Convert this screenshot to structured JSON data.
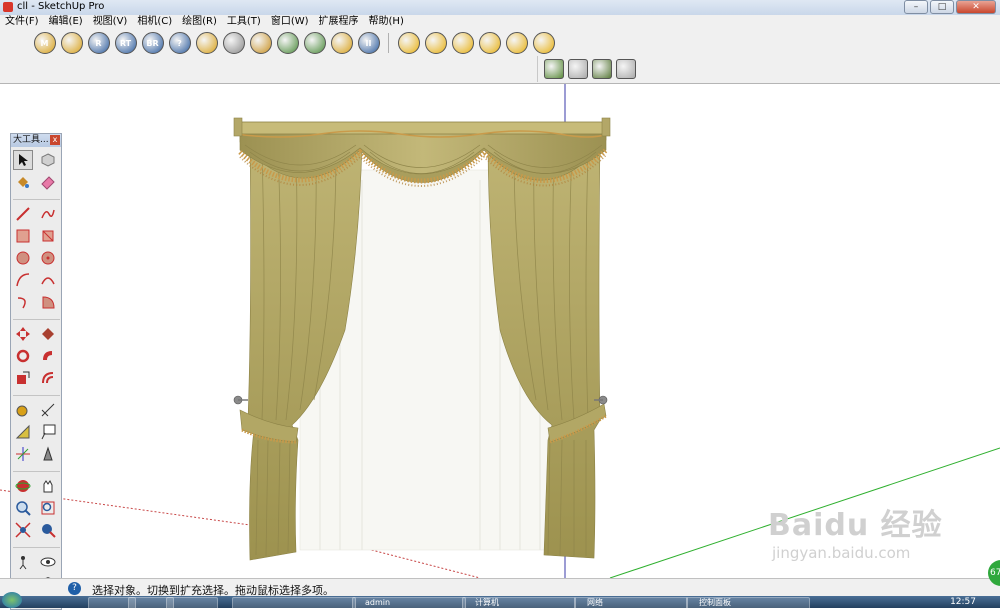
{
  "window": {
    "title": "cll - SketchUp Pro"
  },
  "window_buttons": {
    "minimize": "–",
    "maximize": "□",
    "close": "✕"
  },
  "menu": [
    "文件(F)",
    "编辑(E)",
    "视图(V)",
    "相机(C)",
    "绘图(R)",
    "工具(T)",
    "窗口(W)",
    "扩展程序",
    "帮助(H)"
  ],
  "toolbar1": [
    {
      "label": "M",
      "color": "#d8a018"
    },
    {
      "label": "",
      "color": "#d8a018"
    },
    {
      "label": "R",
      "color": "#2a5a9c"
    },
    {
      "label": "RT",
      "color": "#2a5a9c"
    },
    {
      "label": "BR",
      "color": "#2a5a9c"
    },
    {
      "label": "?",
      "color": "#2a5a9c"
    },
    {
      "label": "",
      "color": "#d8a018"
    },
    {
      "label": "",
      "color": "#8a8a8a"
    },
    {
      "label": "",
      "color": "#c89020"
    },
    {
      "label": "",
      "color": "#4a8a3a"
    },
    {
      "label": "",
      "color": "#4a8a3a"
    },
    {
      "label": "",
      "color": "#d8a018"
    },
    {
      "label": "II",
      "color": "#2a5a9c"
    }
  ],
  "toolbar1b": [
    {
      "label": "",
      "color": "#e8b010"
    },
    {
      "label": "",
      "color": "#e8b010"
    },
    {
      "label": "",
      "color": "#e8b010"
    },
    {
      "label": "",
      "color": "#e8b010"
    },
    {
      "label": "",
      "color": "#e8b010"
    },
    {
      "label": "",
      "color": "#e8b010"
    }
  ],
  "toolbar2": [
    {
      "label": "",
      "color": "#5a8a3a"
    },
    {
      "label": "",
      "color": "#a8a8a8"
    },
    {
      "label": "",
      "color": "#5a7a3a"
    },
    {
      "label": "",
      "color": "#a8a8a8"
    }
  ],
  "palette": {
    "title": "大工具...",
    "close": "x"
  },
  "status": {
    "text": "选择对象。切换到扩充选择。拖动鼠标选择多项。",
    "help": "?"
  },
  "taskbar": {
    "tasks": [
      "",
      "",
      "",
      "",
      "admin",
      "计算机",
      "网络",
      "控制面板"
    ],
    "clock": "12:57"
  },
  "badge": {
    "text": "67"
  },
  "watermark": {
    "main": "Baidu 经验",
    "sub": "jingyan.baidu.com"
  },
  "colors": {
    "curtain": "#b8ad6a",
    "curtain_dark": "#958a4e",
    "tassel": "#c99a4a",
    "axis_blue": "#3a3aa8",
    "axis_green": "#2fb02f",
    "axis_red": "#c84848"
  }
}
